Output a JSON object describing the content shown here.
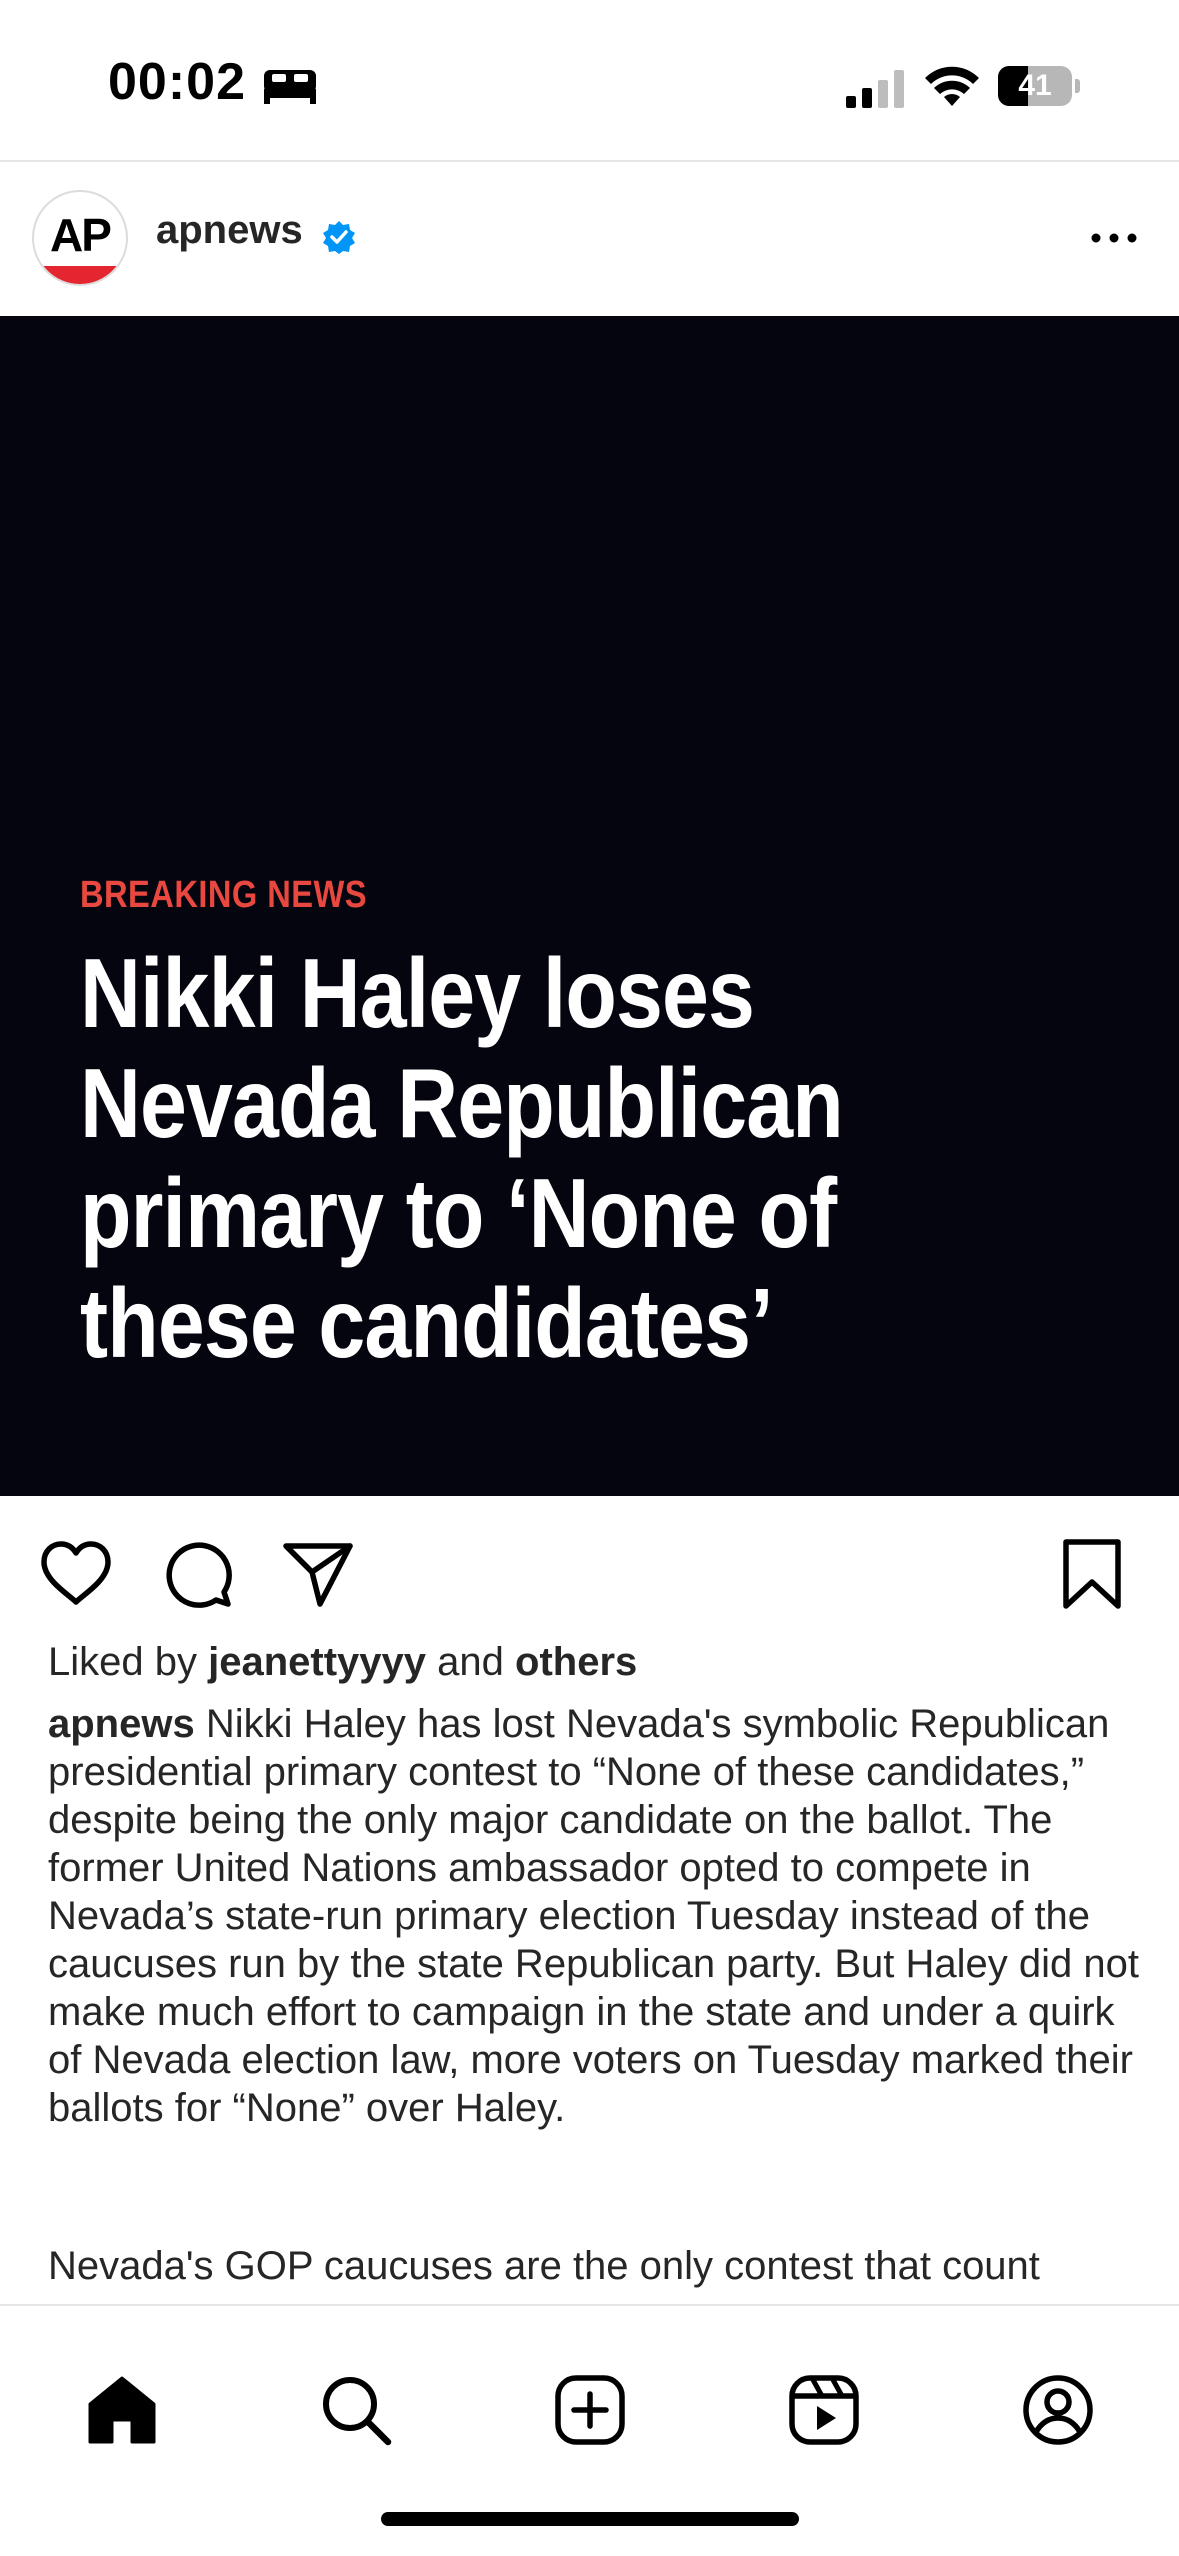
{
  "status_bar": {
    "time": "00:02",
    "sleep_icon": "bed-icon",
    "signal_icon": "cellular-signal-icon",
    "wifi_icon": "wifi-icon",
    "battery_percent": "41",
    "battery_level": 0.41
  },
  "post": {
    "avatar_text": "AP",
    "username": "apnews",
    "verified_icon": "verified-badge-icon",
    "more_icon": "more-dots-icon",
    "media": {
      "kicker": "BREAKING NEWS",
      "headline": "Nikki Haley loses Nevada Republican primary to ‘None of these candidates’",
      "kicker_color": "#e8483f",
      "background_color": "#05050f"
    },
    "actions": {
      "like_icon": "heart-icon",
      "comment_icon": "comment-bubble-icon",
      "share_icon": "paper-plane-icon",
      "save_icon": "bookmark-icon"
    },
    "likes": {
      "prefix": "Liked by",
      "user": "jeanettyyyy",
      "middle": "and",
      "suffix": "others"
    },
    "caption_user": "apnews",
    "caption_text": "Nikki Haley has lost Nevada's symbolic Republican presidential primary contest to “None of these candidates,” despite being the only major candidate on the ballot. The former United Nations ambassador opted to compete in Nevada’s state-run primary election Tuesday instead of the caucuses run by the state Republican party. But Haley did not make much effort to campaign in the state and under a quirk of Nevada election law, more voters on Tuesday marked their ballots for “None” over Haley.",
    "caption_text_2": "Nevada's GOP caucuses are the only contest that count"
  },
  "bottom_nav": {
    "items": [
      {
        "icon": "home-icon"
      },
      {
        "icon": "search-icon"
      },
      {
        "icon": "create-post-icon"
      },
      {
        "icon": "reels-icon"
      },
      {
        "icon": "profile-icon"
      }
    ]
  }
}
